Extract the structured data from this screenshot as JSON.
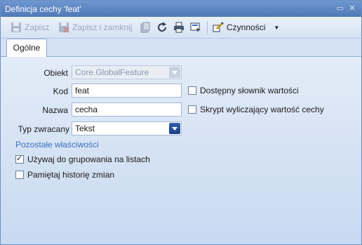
{
  "window": {
    "title": "Definicja cechy 'feat'"
  },
  "toolbar": {
    "save_label": "Zapisz",
    "save_close_label": "Zapisz i zamknij",
    "actions_label": "Czynności"
  },
  "tabs": [
    {
      "label": "Ogólne"
    }
  ],
  "form": {
    "object": {
      "label": "Obiekt",
      "value": "Core.GlobalFeature"
    },
    "code": {
      "label": "Kod",
      "value": "feat"
    },
    "name": {
      "label": "Nazwa",
      "value": "cecha"
    },
    "return_type": {
      "label": "Typ zwracany",
      "value": "Tekst"
    },
    "dictionary_label": "Dostępny słownik wartości",
    "script_label": "Skrypt wyliczający wartość cechy",
    "other_section": "Pozostałe właściwości",
    "use_grouping_label": "Używaj do grupowania na listach",
    "remember_history_label": "Pamiętaj historię zmian"
  },
  "colors": {
    "accent": "#3b6fc4",
    "titlebar": "#5b84c1"
  }
}
